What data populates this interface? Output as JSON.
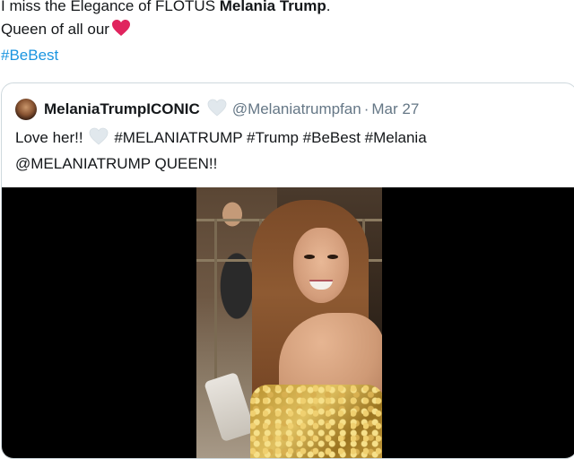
{
  "tweet": {
    "text_line1_prefix": "I miss the Elegance of FLOTUS ",
    "text_line1_bold": "Melania Trump",
    "text_line1_suffix": ".",
    "text_line2": "Queen of all our",
    "hashtag": "#BeBest",
    "heart_color": "#e0245e"
  },
  "quoted_tweet": {
    "display_name": "MelaniaTrumpICONIC",
    "handle": "@Melaniatrumpfan",
    "separator": "·",
    "date": "Mar 27",
    "body_line1_prefix": "Love her!!",
    "body_line1_suffix": "#MELANIATRUMP #Trump #BeBest #Melania",
    "body_line2": "@MELANIATRUMP QUEEN!!",
    "heart_color": "#e1e8ed"
  },
  "colors": {
    "text": "#14171a",
    "secondary": "#657786",
    "link": "#1b95e0",
    "border": "#cfd9de",
    "media_bg": "#000000"
  },
  "icons": {
    "red_heart": "red-heart-emoji",
    "white_heart": "white-heart-emoji"
  }
}
